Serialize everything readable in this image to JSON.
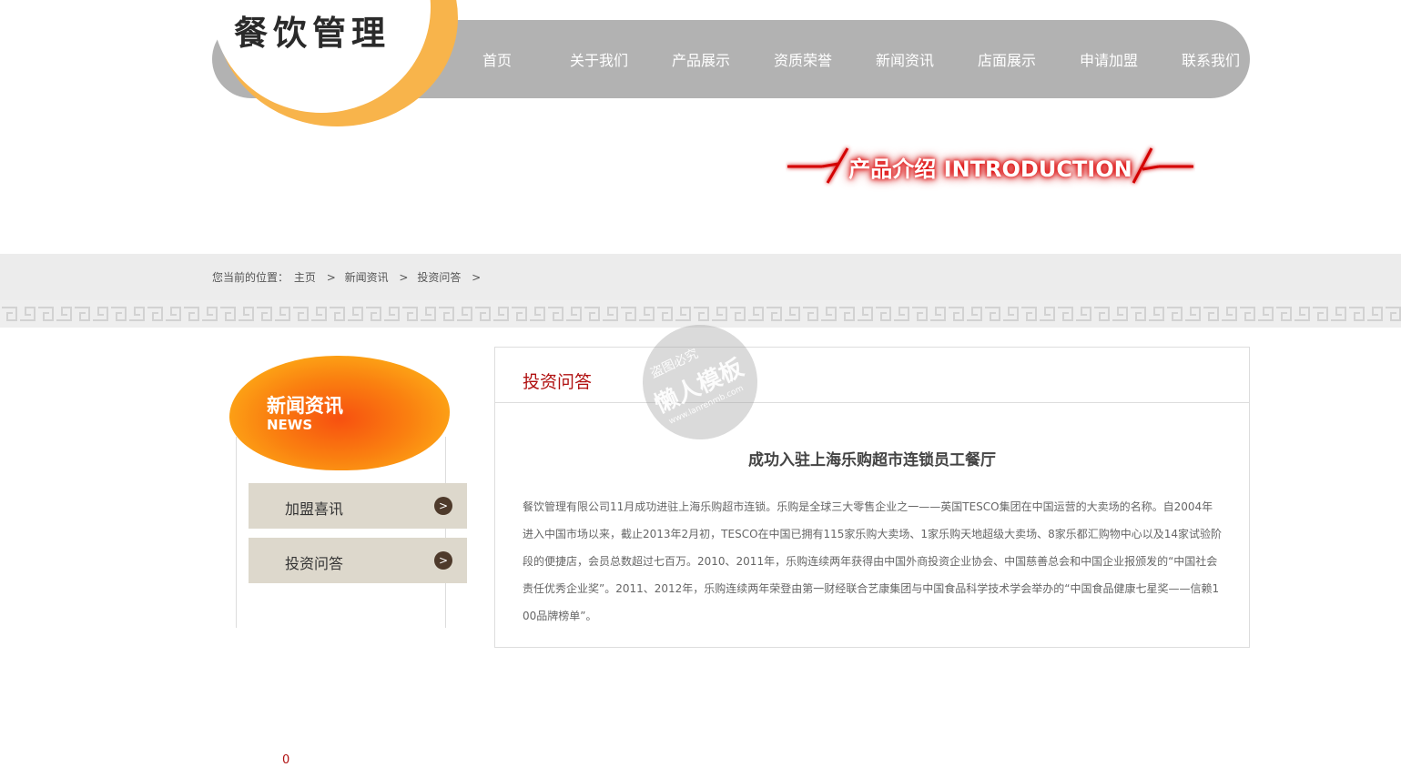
{
  "logo": {
    "text": "餐饮管理"
  },
  "nav": {
    "items": [
      "首页",
      "关于我们",
      "产品展示",
      "资质荣誉",
      "新闻资讯",
      "店面展示",
      "申请加盟",
      "联系我们"
    ]
  },
  "banner": {
    "text": "产品介绍  INTRODUCTION"
  },
  "breadcrumb": {
    "prefix": "您当前的位置：",
    "items": [
      "主页",
      "新闻资讯",
      "投资问答"
    ],
    "separator": ">"
  },
  "sidebar": {
    "title": "新闻资讯",
    "subtitle": "NEWS",
    "menu": [
      {
        "label": "加盟喜讯",
        "arrow": ">"
      },
      {
        "label": "投资问答",
        "arrow": ">"
      }
    ]
  },
  "panel": {
    "title": "投资问答",
    "article_title": "成功入驻上海乐购超市连锁员工餐厅",
    "article_body": "餐饮管理有限公司11月成功进驻上海乐购超市连锁。乐购是全球三大零售企业之一——英国TESCO集团在中国运营的大卖场的名称。自2004年进入中国市场以来，截止2013年2月初，TESCO在中国已拥有115家乐购大卖场、1家乐购天地超级大卖场、8家乐都汇购物中心以及14家试验阶段的便捷店，会员总数超过七百万。2010、2011年，乐购连续两年获得由中国外商投资企业协会、中国慈善总会和中国企业报颁发的“中国社会责任优秀企业奖”。2011、2012年，乐购连续两年荣登由第一财经联合艺康集团与中国食品科学技术学会举办的“中国食品健康七星奖——信赖100品牌榜单”。"
  },
  "watermark": {
    "line1": "盗图必究",
    "line2": "懒人模板",
    "line3": "www.lanrenmb.com"
  },
  "footer": {
    "counter": "0"
  },
  "colors": {
    "nav_bg": "#b2b2b2",
    "logo_ring": "#f8b44b",
    "accent_red": "#b01010",
    "menu_bg": "#ddd8cc",
    "arrow_bg": "#4e3a2b"
  }
}
